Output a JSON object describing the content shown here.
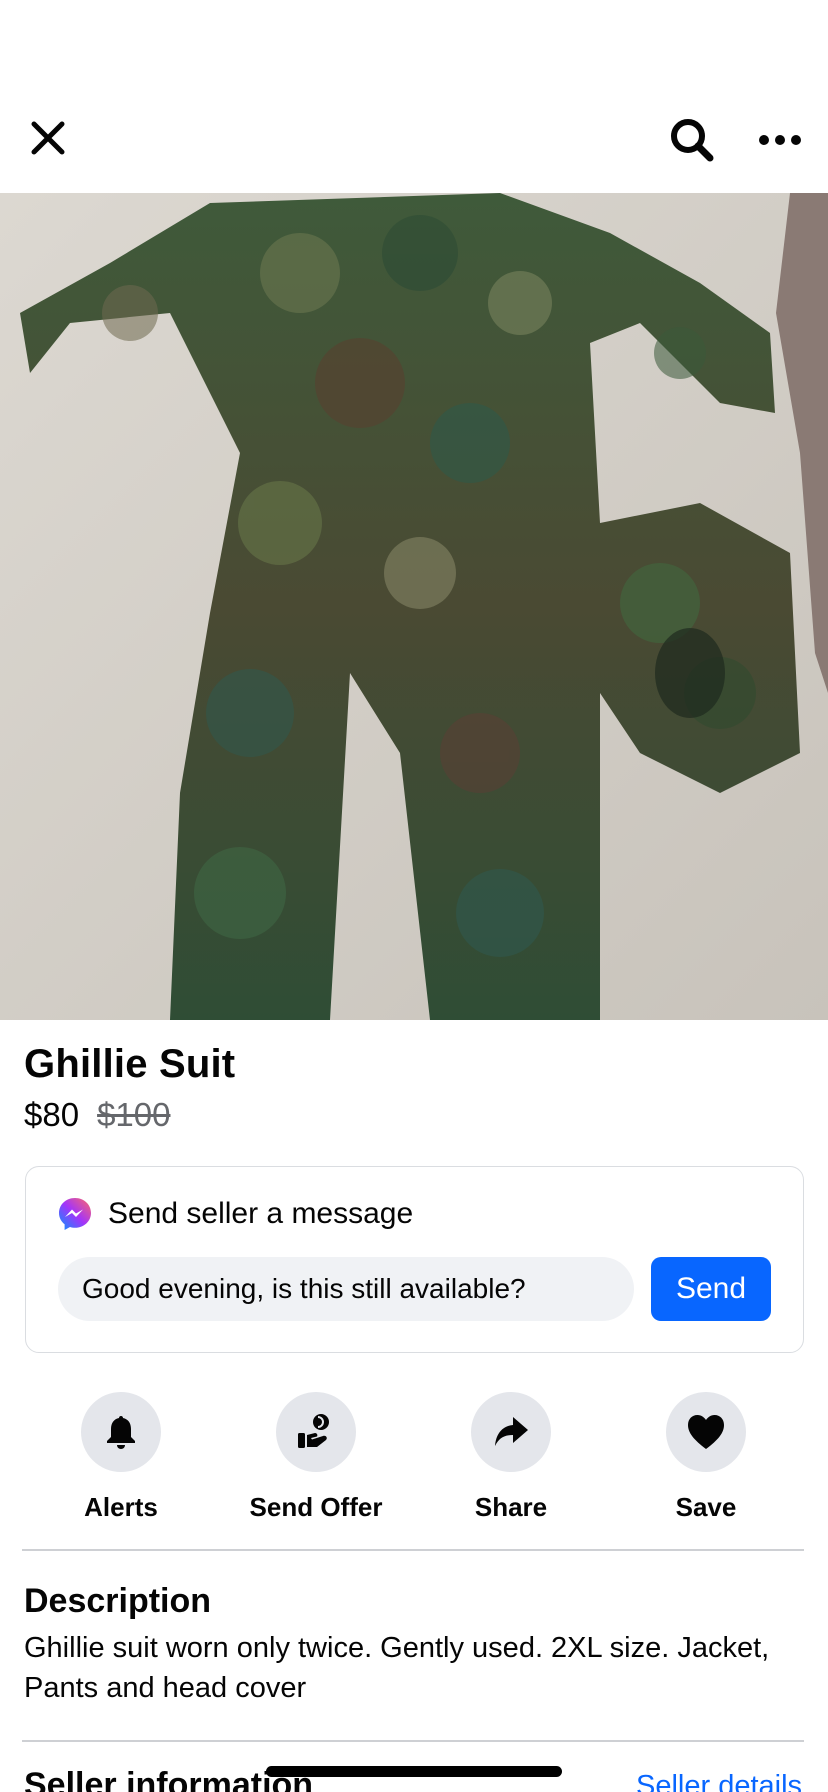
{
  "header": {
    "close_icon": "close-icon",
    "search_icon": "search-icon",
    "more_icon": "more-horizontal-icon"
  },
  "listing": {
    "title": "Ghillie Suit",
    "price": "$80",
    "original_price": "$100",
    "photo": "listing-photo"
  },
  "message_card": {
    "heading": "Send seller a message",
    "icon": "messenger-icon",
    "input_value": "Good evening, is this still available?",
    "send_label": "Send",
    "accent_color": "#0866ff"
  },
  "actions": [
    {
      "label": "Alerts",
      "icon": "bell-icon"
    },
    {
      "label": "Send Offer",
      "icon": "offer-hand-icon"
    },
    {
      "label": "Share",
      "icon": "share-arrow-icon"
    },
    {
      "label": "Save",
      "icon": "heart-icon"
    }
  ],
  "description": {
    "heading": "Description",
    "text": "Ghillie suit worn only twice. Gently used. 2XL size. Jacket, Pants and head cover"
  },
  "seller": {
    "heading": "Seller information",
    "link": "Seller details"
  }
}
